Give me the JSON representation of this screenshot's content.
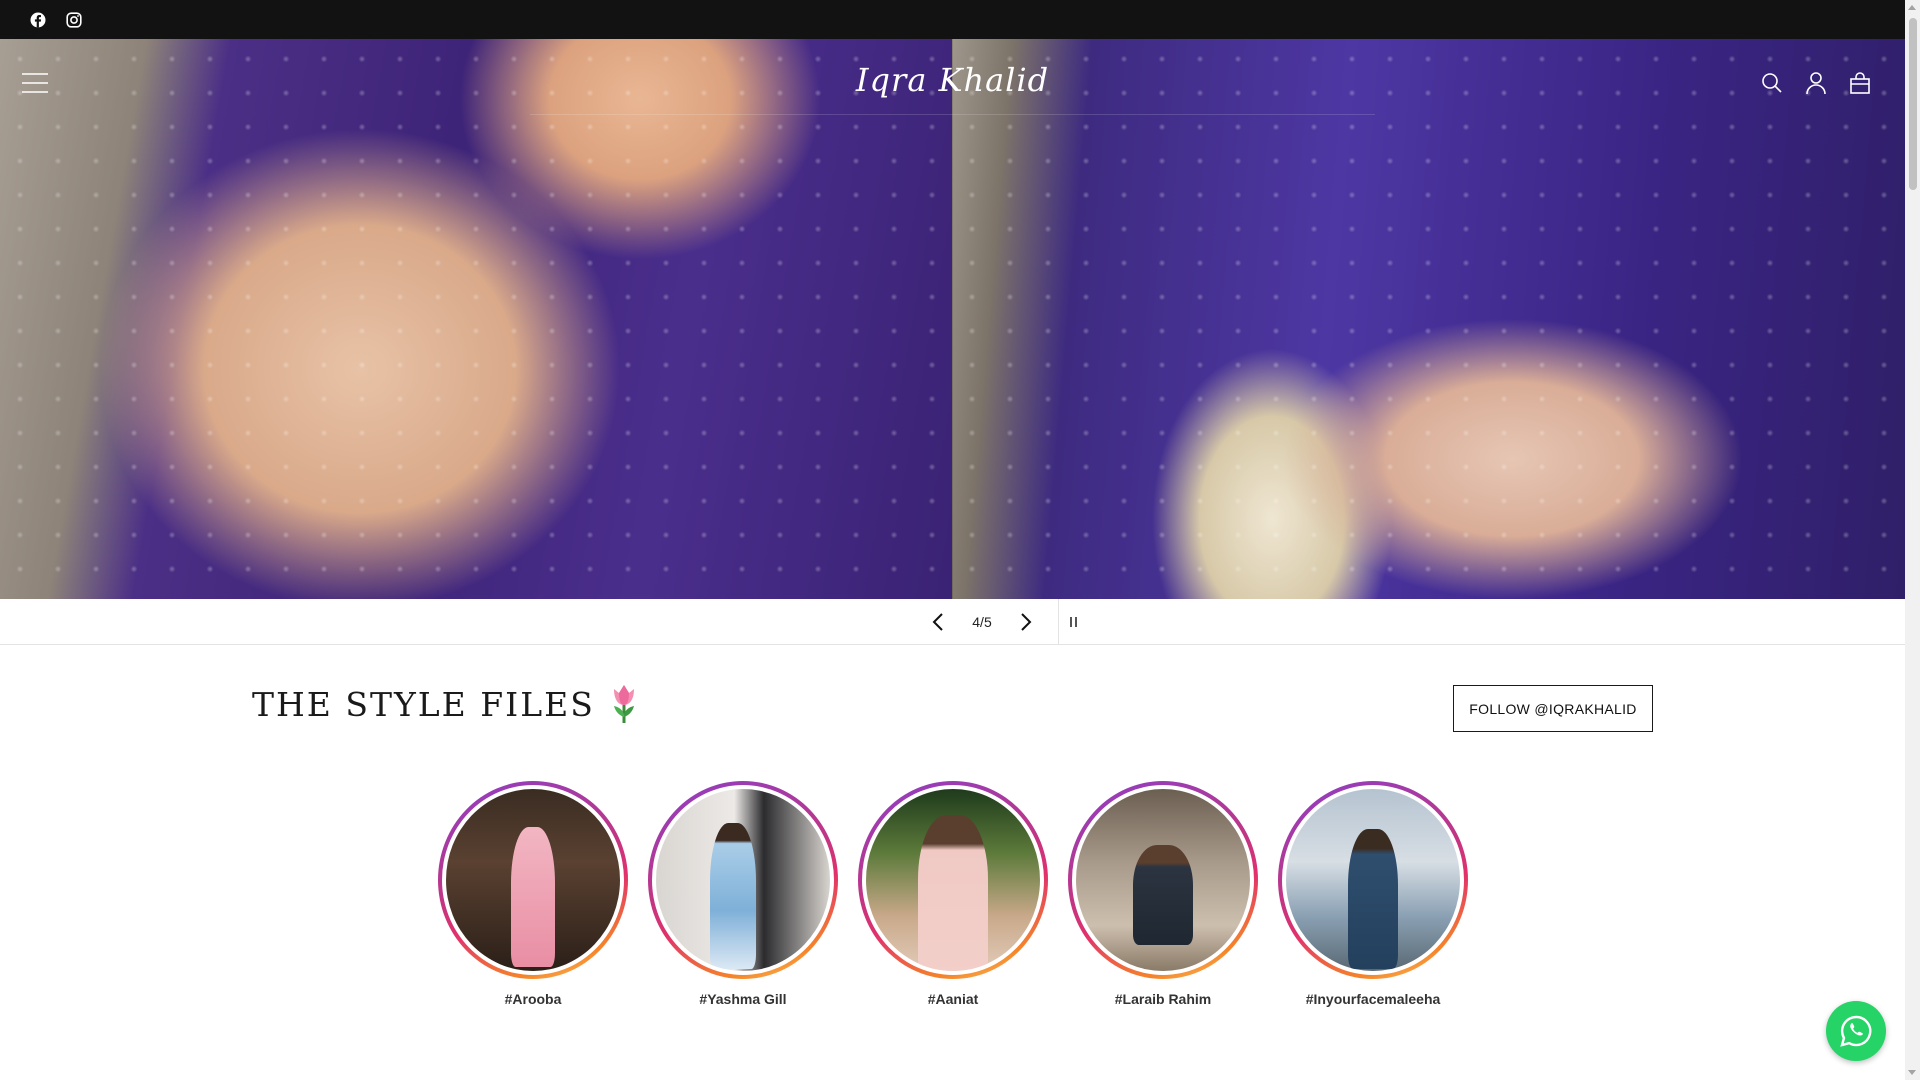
{
  "topbar": {
    "social": [
      {
        "name": "facebook-icon"
      },
      {
        "name": "instagram-icon"
      }
    ]
  },
  "header": {
    "logo_text": "Iqra Khalid",
    "menu_icon": "hamburger-menu-icon",
    "search_icon": "search-icon",
    "account_icon": "account-icon",
    "cart_icon": "shopping-bag-icon"
  },
  "slideshow": {
    "counter": "4/5",
    "prev_icon": "chevron-left-icon",
    "next_icon": "chevron-right-icon",
    "pause_icon": "pause-icon"
  },
  "style_files": {
    "title": "THE STYLE FILES",
    "emoji": "tulip-icon",
    "follow_label": "FOLLOW @IQRAKHALID",
    "stories": [
      {
        "label": "#Arooba"
      },
      {
        "label": "#Yashma Gill"
      },
      {
        "label": "#Aaniat"
      },
      {
        "label": "#Laraib Rahim"
      },
      {
        "label": "#Inyourfacemaleeha"
      }
    ]
  },
  "whatsapp": {
    "icon": "whatsapp-icon"
  },
  "colors": {
    "topbar": "#121212",
    "story_ring_start": "#8b3fc7",
    "story_ring_end": "#f58529",
    "whatsapp": "#25d366"
  }
}
